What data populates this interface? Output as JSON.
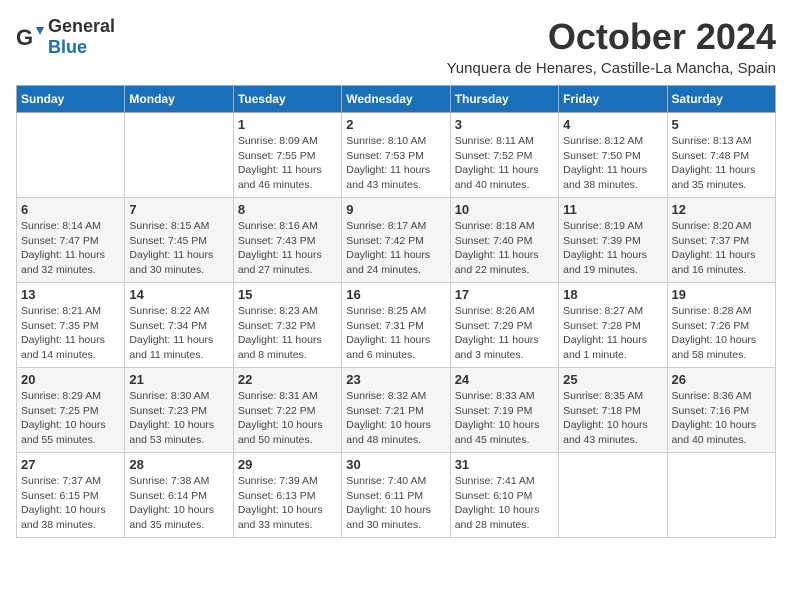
{
  "header": {
    "logo_general": "General",
    "logo_blue": "Blue",
    "month_title": "October 2024",
    "subtitle": "Yunquera de Henares, Castille-La Mancha, Spain"
  },
  "weekdays": [
    "Sunday",
    "Monday",
    "Tuesday",
    "Wednesday",
    "Thursday",
    "Friday",
    "Saturday"
  ],
  "weeks": [
    [
      {
        "day": "",
        "info": ""
      },
      {
        "day": "",
        "info": ""
      },
      {
        "day": "1",
        "info": "Sunrise: 8:09 AM\nSunset: 7:55 PM\nDaylight: 11 hours and 46 minutes."
      },
      {
        "day": "2",
        "info": "Sunrise: 8:10 AM\nSunset: 7:53 PM\nDaylight: 11 hours and 43 minutes."
      },
      {
        "day": "3",
        "info": "Sunrise: 8:11 AM\nSunset: 7:52 PM\nDaylight: 11 hours and 40 minutes."
      },
      {
        "day": "4",
        "info": "Sunrise: 8:12 AM\nSunset: 7:50 PM\nDaylight: 11 hours and 38 minutes."
      },
      {
        "day": "5",
        "info": "Sunrise: 8:13 AM\nSunset: 7:48 PM\nDaylight: 11 hours and 35 minutes."
      }
    ],
    [
      {
        "day": "6",
        "info": "Sunrise: 8:14 AM\nSunset: 7:47 PM\nDaylight: 11 hours and 32 minutes."
      },
      {
        "day": "7",
        "info": "Sunrise: 8:15 AM\nSunset: 7:45 PM\nDaylight: 11 hours and 30 minutes."
      },
      {
        "day": "8",
        "info": "Sunrise: 8:16 AM\nSunset: 7:43 PM\nDaylight: 11 hours and 27 minutes."
      },
      {
        "day": "9",
        "info": "Sunrise: 8:17 AM\nSunset: 7:42 PM\nDaylight: 11 hours and 24 minutes."
      },
      {
        "day": "10",
        "info": "Sunrise: 8:18 AM\nSunset: 7:40 PM\nDaylight: 11 hours and 22 minutes."
      },
      {
        "day": "11",
        "info": "Sunrise: 8:19 AM\nSunset: 7:39 PM\nDaylight: 11 hours and 19 minutes."
      },
      {
        "day": "12",
        "info": "Sunrise: 8:20 AM\nSunset: 7:37 PM\nDaylight: 11 hours and 16 minutes."
      }
    ],
    [
      {
        "day": "13",
        "info": "Sunrise: 8:21 AM\nSunset: 7:35 PM\nDaylight: 11 hours and 14 minutes."
      },
      {
        "day": "14",
        "info": "Sunrise: 8:22 AM\nSunset: 7:34 PM\nDaylight: 11 hours and 11 minutes."
      },
      {
        "day": "15",
        "info": "Sunrise: 8:23 AM\nSunset: 7:32 PM\nDaylight: 11 hours and 8 minutes."
      },
      {
        "day": "16",
        "info": "Sunrise: 8:25 AM\nSunset: 7:31 PM\nDaylight: 11 hours and 6 minutes."
      },
      {
        "day": "17",
        "info": "Sunrise: 8:26 AM\nSunset: 7:29 PM\nDaylight: 11 hours and 3 minutes."
      },
      {
        "day": "18",
        "info": "Sunrise: 8:27 AM\nSunset: 7:28 PM\nDaylight: 11 hours and 1 minute."
      },
      {
        "day": "19",
        "info": "Sunrise: 8:28 AM\nSunset: 7:26 PM\nDaylight: 10 hours and 58 minutes."
      }
    ],
    [
      {
        "day": "20",
        "info": "Sunrise: 8:29 AM\nSunset: 7:25 PM\nDaylight: 10 hours and 55 minutes."
      },
      {
        "day": "21",
        "info": "Sunrise: 8:30 AM\nSunset: 7:23 PM\nDaylight: 10 hours and 53 minutes."
      },
      {
        "day": "22",
        "info": "Sunrise: 8:31 AM\nSunset: 7:22 PM\nDaylight: 10 hours and 50 minutes."
      },
      {
        "day": "23",
        "info": "Sunrise: 8:32 AM\nSunset: 7:21 PM\nDaylight: 10 hours and 48 minutes."
      },
      {
        "day": "24",
        "info": "Sunrise: 8:33 AM\nSunset: 7:19 PM\nDaylight: 10 hours and 45 minutes."
      },
      {
        "day": "25",
        "info": "Sunrise: 8:35 AM\nSunset: 7:18 PM\nDaylight: 10 hours and 43 minutes."
      },
      {
        "day": "26",
        "info": "Sunrise: 8:36 AM\nSunset: 7:16 PM\nDaylight: 10 hours and 40 minutes."
      }
    ],
    [
      {
        "day": "27",
        "info": "Sunrise: 7:37 AM\nSunset: 6:15 PM\nDaylight: 10 hours and 38 minutes."
      },
      {
        "day": "28",
        "info": "Sunrise: 7:38 AM\nSunset: 6:14 PM\nDaylight: 10 hours and 35 minutes."
      },
      {
        "day": "29",
        "info": "Sunrise: 7:39 AM\nSunset: 6:13 PM\nDaylight: 10 hours and 33 minutes."
      },
      {
        "day": "30",
        "info": "Sunrise: 7:40 AM\nSunset: 6:11 PM\nDaylight: 10 hours and 30 minutes."
      },
      {
        "day": "31",
        "info": "Sunrise: 7:41 AM\nSunset: 6:10 PM\nDaylight: 10 hours and 28 minutes."
      },
      {
        "day": "",
        "info": ""
      },
      {
        "day": "",
        "info": ""
      }
    ]
  ]
}
